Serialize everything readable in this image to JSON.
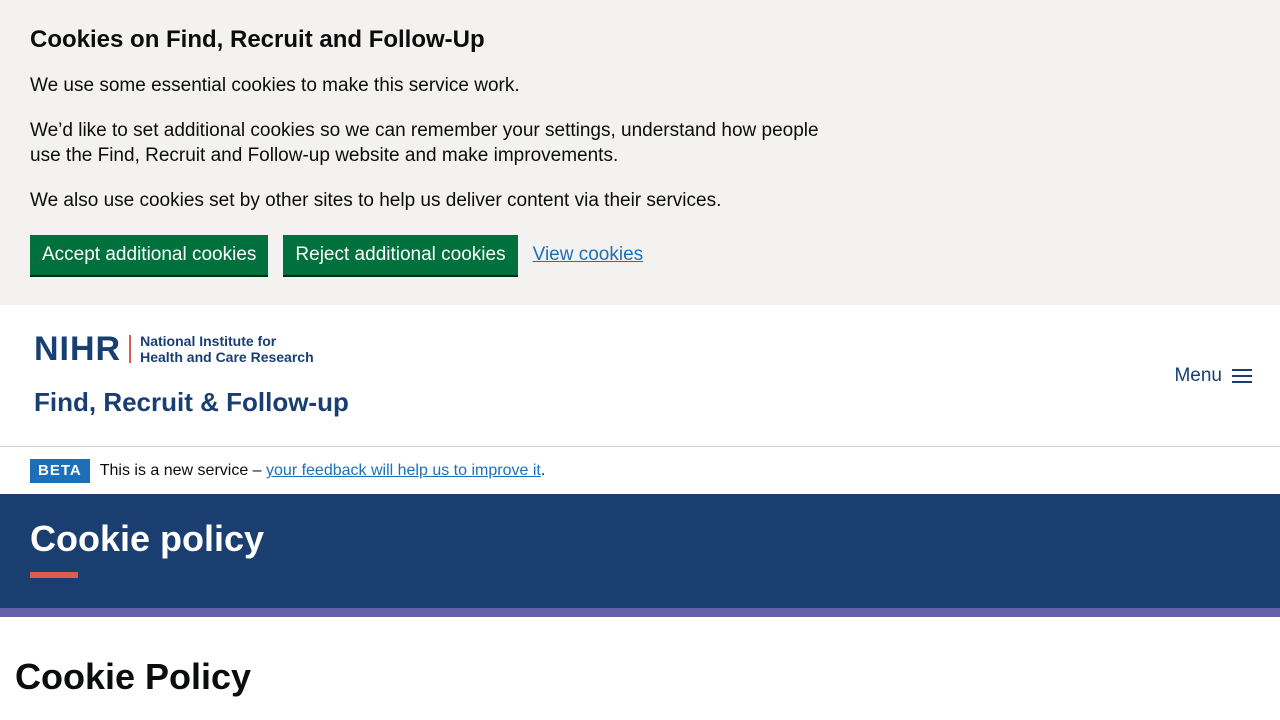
{
  "cookie_banner": {
    "title": "Cookies on Find, Recruit and Follow-Up",
    "paragraphs": [
      "We use some essential cookies to make this service work.",
      "We’d like to set additional cookies so we can remember your settings, understand how people use the Find, Recruit and Follow-up website and make improvements.",
      "We also use cookies set by other sites to help us deliver content via their services."
    ],
    "accept_label": "Accept additional cookies",
    "reject_label": "Reject additional cookies",
    "view_label": "View cookies"
  },
  "header": {
    "logo_mark": "NIHR",
    "logo_line1": "National Institute for",
    "logo_line2": "Health and Care Research",
    "service_name": "Find, Recruit & Follow-up",
    "menu_label": "Menu"
  },
  "phase_banner": {
    "tag": "BETA",
    "text": "This is a new service – ",
    "link": "your feedback will help us to improve it",
    "suffix": "."
  },
  "hero": {
    "title": "Cookie policy"
  },
  "main": {
    "title": "Cookie Policy"
  },
  "colors": {
    "banner_bg": "#f3f2f1",
    "button_green": "#00703c",
    "link_blue": "#1d70b8",
    "brand_navy": "#1b3e71",
    "accent_red": "#e05a4e",
    "strip_purple": "#6560a8"
  }
}
